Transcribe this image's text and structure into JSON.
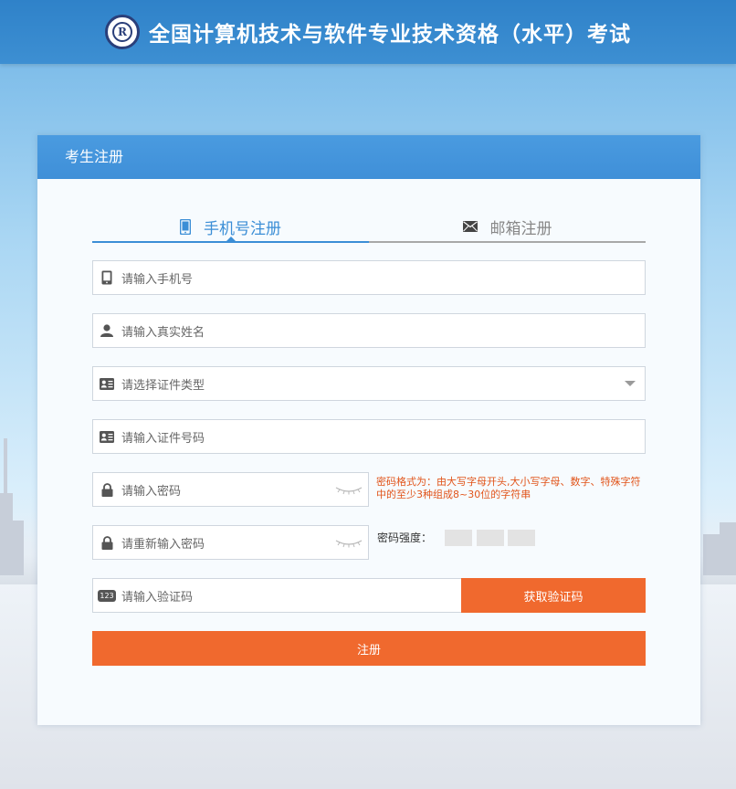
{
  "header": {
    "title": "全国计算机技术与软件专业技术资格（水平）考试",
    "logo_text": "R"
  },
  "card": {
    "title": "考生注册"
  },
  "tabs": [
    {
      "label": "手机号注册",
      "icon": "mobile-icon",
      "active": true
    },
    {
      "label": "邮箱注册",
      "icon": "envelope-icon",
      "active": false
    }
  ],
  "form": {
    "phone_placeholder": "请输入手机号",
    "name_placeholder": "请输入真实姓名",
    "id_type_placeholder": "请选择证件类型",
    "id_number_placeholder": "请输入证件号码",
    "password_placeholder": "请输入密码",
    "password_confirm_placeholder": "请重新输入密码",
    "captcha_placeholder": "请输入验证码",
    "captcha_icon_text": "123",
    "password_hint": "密码格式为：由大写字母开头,大小写字母、数字、特殊字符中的至少3种组成8~30位的字符串",
    "strength_label": "密码强度：",
    "get_code_button": "获取验证码",
    "register_button": "注册"
  },
  "colors": {
    "header": "#2f82c9",
    "accent": "#3b8ed6",
    "orange": "#f0692e",
    "hint": "#e1541a"
  }
}
